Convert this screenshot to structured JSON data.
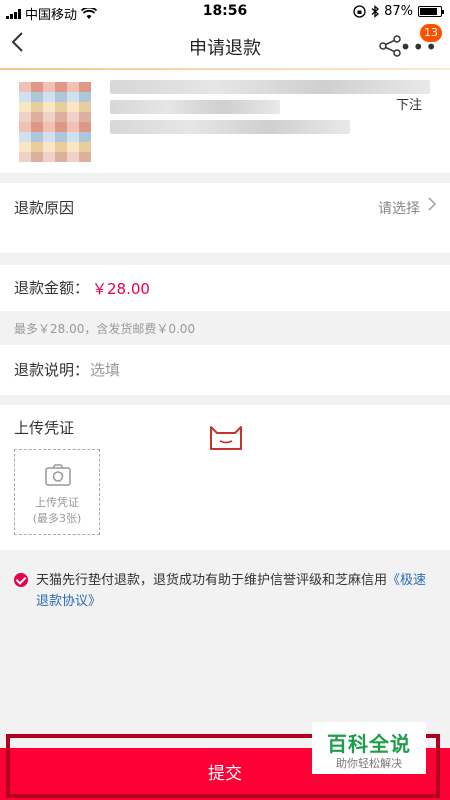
{
  "status_bar": {
    "carrier": "中国移动",
    "time": "18:56",
    "battery": "87%",
    "battery_level": 0.87,
    "icons": [
      "signal-icon",
      "wifi-icon",
      "orientation-lock-icon",
      "bluetooth-icon",
      "battery-icon"
    ]
  },
  "nav": {
    "title": "申请退款",
    "back_icon": "back-arrow-icon",
    "share_icon": "share-icon",
    "more_icon": "more-icon",
    "badge": "13",
    "badge_color": "#ff5000"
  },
  "product": {
    "tag": "下注"
  },
  "refund_reason": {
    "label": "退款原因",
    "value": "请选择"
  },
  "refund_amount": {
    "label": "退款金额：",
    "value": "￥28.00",
    "hint": "最多￥28.00，含发货邮费￥0.00",
    "accent_color": "#e5004f"
  },
  "refund_desc": {
    "label": "退款说明：",
    "placeholder": "选填"
  },
  "upload": {
    "label": "上传凭证",
    "box_line1": "上传凭证",
    "box_line2": "(最多3张)",
    "camera_icon": "camera-icon",
    "logo_icon": "tmall-logo-icon"
  },
  "notice": {
    "text": "天猫先行垫付退款，退货成功有助于维护信誉评级和芝麻信用",
    "link": "《极速退款协议》",
    "check_icon": "checkmark-icon"
  },
  "submit": {
    "label": "提交",
    "color": "#ff0036"
  },
  "watermark": {
    "title": "百科全说",
    "subtitle": "助你轻松解决"
  }
}
